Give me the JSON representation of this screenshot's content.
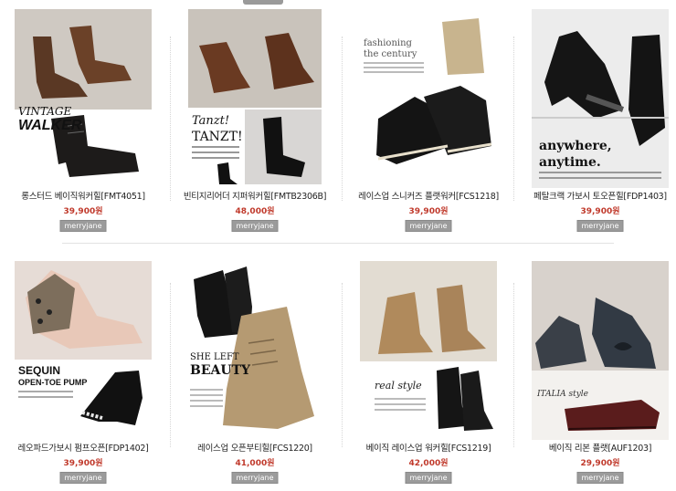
{
  "products": [
    {
      "name": "롱스터드 베이직워커힐[FMT4051]",
      "price": "39,900원",
      "brand": "merryjane",
      "overlay": {
        "title1": "VINTAGE",
        "title2": "WALKER"
      }
    },
    {
      "name": "빈티지리어더 지퍼워커힐[FMTB2306B]",
      "price": "48,000원",
      "brand": "merryjane",
      "overlay": {
        "title1": "Tanzt!",
        "title2": "TANZT!"
      }
    },
    {
      "name": "레이스업 스니커즈 플랫워커[FCS1218]",
      "price": "39,900원",
      "brand": "merryjane",
      "overlay": {
        "title1": "fashioning",
        "title2": "the century"
      }
    },
    {
      "name": "페탈크랙 가보시 토오픈힐[FDP1403]",
      "price": "39,900원",
      "brand": "merryjane",
      "overlay": {
        "title1": "anywhere,",
        "title2": "anytime."
      }
    },
    {
      "name": "레오파드가보시 펌프오픈[FDP1402]",
      "price": "39,900원",
      "brand": "merryjane",
      "overlay": {
        "title1": "SEQUIN",
        "title2": "OPEN-TOE PUMP"
      }
    },
    {
      "name": "레이스업 오픈부티힐[FCS1220]",
      "price": "41,000원",
      "brand": "merryjane",
      "overlay": {
        "title1": "SHE LEFT",
        "title2": "BEAUTY"
      }
    },
    {
      "name": "베이직 레이스업 워커힐[FCS1219]",
      "price": "42,000원",
      "brand": "merryjane",
      "overlay": {
        "title1": "real style",
        "title2": ""
      }
    },
    {
      "name": "베이직 리본 플랫[AUF1203]",
      "price": "29,900원",
      "brand": "merryjane",
      "overlay": {
        "title1": "ITALIA style",
        "title2": ""
      }
    }
  ],
  "colors": {
    "price": "#c0392b",
    "brand_badge": "#9b9b9b",
    "separator": "#d6d6d6"
  },
  "icons": [
    "boot-photo",
    "lace-up-photo",
    "sneaker-photo",
    "pump-photo",
    "leopard-pump-photo",
    "open-bootie-photo",
    "walker-photo",
    "ribbon-flat-photo"
  ]
}
